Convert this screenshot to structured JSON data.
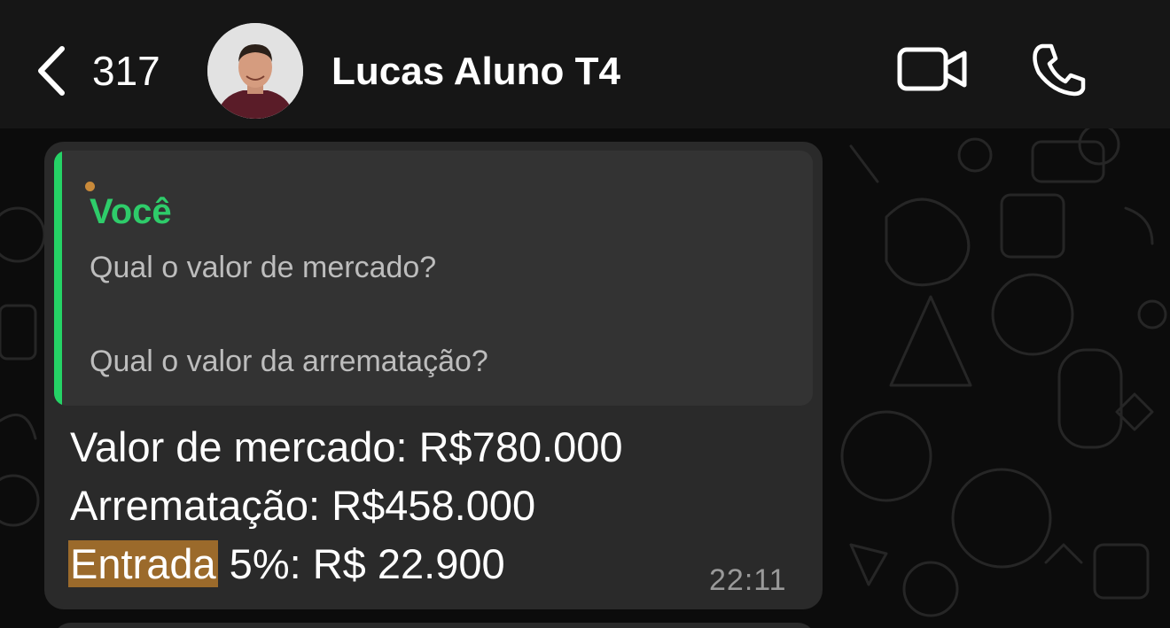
{
  "header": {
    "back_count": "317",
    "contact_name": "Lucas Aluno T4",
    "icons": {
      "back": "chevron-left-icon",
      "video": "video-camera-icon",
      "call": "phone-icon"
    }
  },
  "message": {
    "quote": {
      "author": "Você",
      "lines": [
        "Qual o valor de mercado?",
        "Qual o valor da arrematação?"
      ]
    },
    "body": {
      "line1": "Valor de mercado: R$780.000",
      "line2": "Arrematação: R$458.000",
      "line3_highlight": "Entrada",
      "line3_rest": " 5%: R$ 22.900"
    },
    "time": "22:11"
  },
  "colors": {
    "accent_green": "#25d366",
    "highlight": "#9b6a2b",
    "bubble": "#2a2a2a"
  }
}
